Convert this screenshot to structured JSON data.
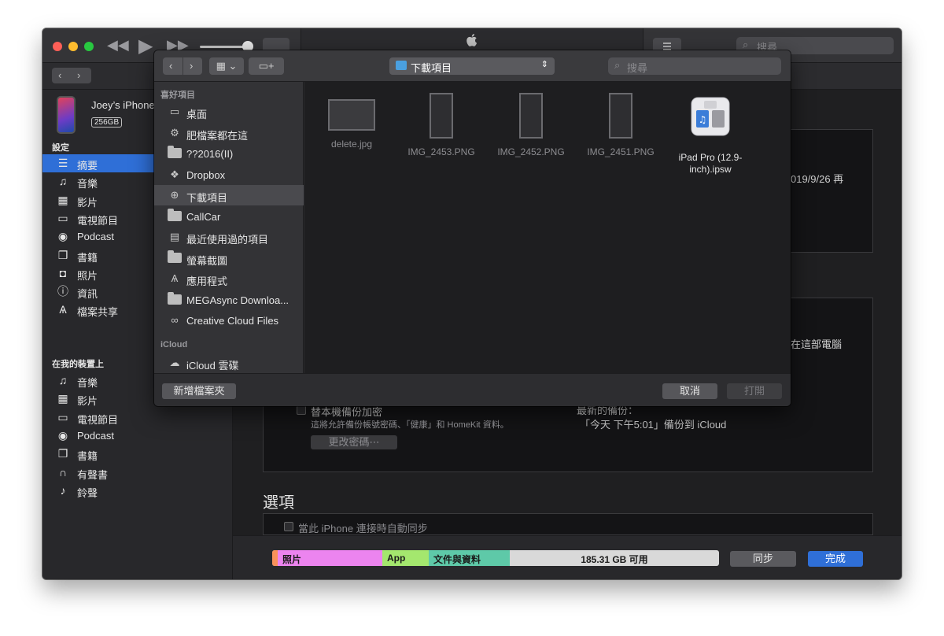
{
  "toolbar": {
    "search_placeholder": "搜尋"
  },
  "device": {
    "name": "Joey’s iPhone",
    "capacity": "256GB"
  },
  "sidebar": {
    "settings_title": "設定",
    "settings_items": [
      {
        "label": "摘要",
        "icon": "summary-icon"
      },
      {
        "label": "音樂",
        "icon": "music-note-icon"
      },
      {
        "label": "影片",
        "icon": "film-icon"
      },
      {
        "label": "電視節目",
        "icon": "tv-icon"
      },
      {
        "label": "Podcast",
        "icon": "podcast-icon"
      },
      {
        "label": "書籍",
        "icon": "book-icon"
      },
      {
        "label": "照片",
        "icon": "camera-icon"
      },
      {
        "label": "資訊",
        "icon": "info-icon"
      },
      {
        "label": "檔案共享",
        "icon": "app-store-icon"
      }
    ],
    "device_title": "在我的裝置上",
    "device_items": [
      {
        "label": "音樂",
        "icon": "music-note-icon"
      },
      {
        "label": "影片",
        "icon": "film-icon"
      },
      {
        "label": "電視節目",
        "icon": "tv-icon"
      },
      {
        "label": "Podcast",
        "icon": "podcast-icon"
      },
      {
        "label": "書籍",
        "icon": "book-icon"
      },
      {
        "label": "有聲書",
        "icon": "headphones-icon"
      },
      {
        "label": "鈴聲",
        "icon": "bell-icon"
      }
    ]
  },
  "background": {
    "update_text": "019/9/26 再",
    "this_computer_text": "在這部電腦",
    "encrypt_label": "替本機備份加密",
    "encrypt_desc": "這將允許備份帳號密碼、「健康」和 HomeKit 資料。",
    "change_password": "更改密碼⋯",
    "latest_backup_label": "最新的備份：",
    "latest_backup_value": "「今天 下午5:01」備份到 iCloud",
    "options_title": "選項",
    "auto_sync_label": "當此 iPhone 連接時自動同步"
  },
  "storage": {
    "photos": "照片",
    "app": "App",
    "docs": "文件與資料",
    "free": "185.31 GB 可用"
  },
  "buttons": {
    "sync": "同步",
    "done": "完成"
  },
  "dialog": {
    "path": "下載項目",
    "search_placeholder": "搜尋",
    "favorites_title": "喜好項目",
    "favorites": [
      {
        "label": "桌面",
        "icon": "desktop-icon"
      },
      {
        "label": "肥檔案都在這",
        "icon": "gear-icon"
      },
      {
        "label": "??2016(II)",
        "icon": "folder-icon"
      },
      {
        "label": "Dropbox",
        "icon": "dropbox-icon"
      },
      {
        "label": "下載項目",
        "icon": "download-icon"
      },
      {
        "label": "CallCar",
        "icon": "folder-icon"
      },
      {
        "label": "最近使用過的項目",
        "icon": "recents-icon"
      },
      {
        "label": "螢幕截圖",
        "icon": "folder-icon"
      },
      {
        "label": "應用程式",
        "icon": "applications-icon"
      },
      {
        "label": "MEGAsync Downloa...",
        "icon": "folder-icon"
      },
      {
        "label": "Creative Cloud Files",
        "icon": "creative-cloud-icon"
      }
    ],
    "icloud_title": "iCloud",
    "icloud_items": [
      {
        "label": "iCloud 雲碟",
        "icon": "cloud-icon"
      }
    ],
    "files": [
      {
        "name": "delete.jpg",
        "kind": "wide"
      },
      {
        "name": "IMG_2453.PNG",
        "kind": "tall"
      },
      {
        "name": "IMG_2452.PNG",
        "kind": "tall"
      },
      {
        "name": "IMG_2451.PNG",
        "kind": "tall"
      },
      {
        "name": "iPad Pro (12.9-inch).ipsw",
        "kind": "ipsw"
      }
    ],
    "new_folder": "新增檔案夾",
    "cancel": "取消",
    "open": "打開"
  }
}
